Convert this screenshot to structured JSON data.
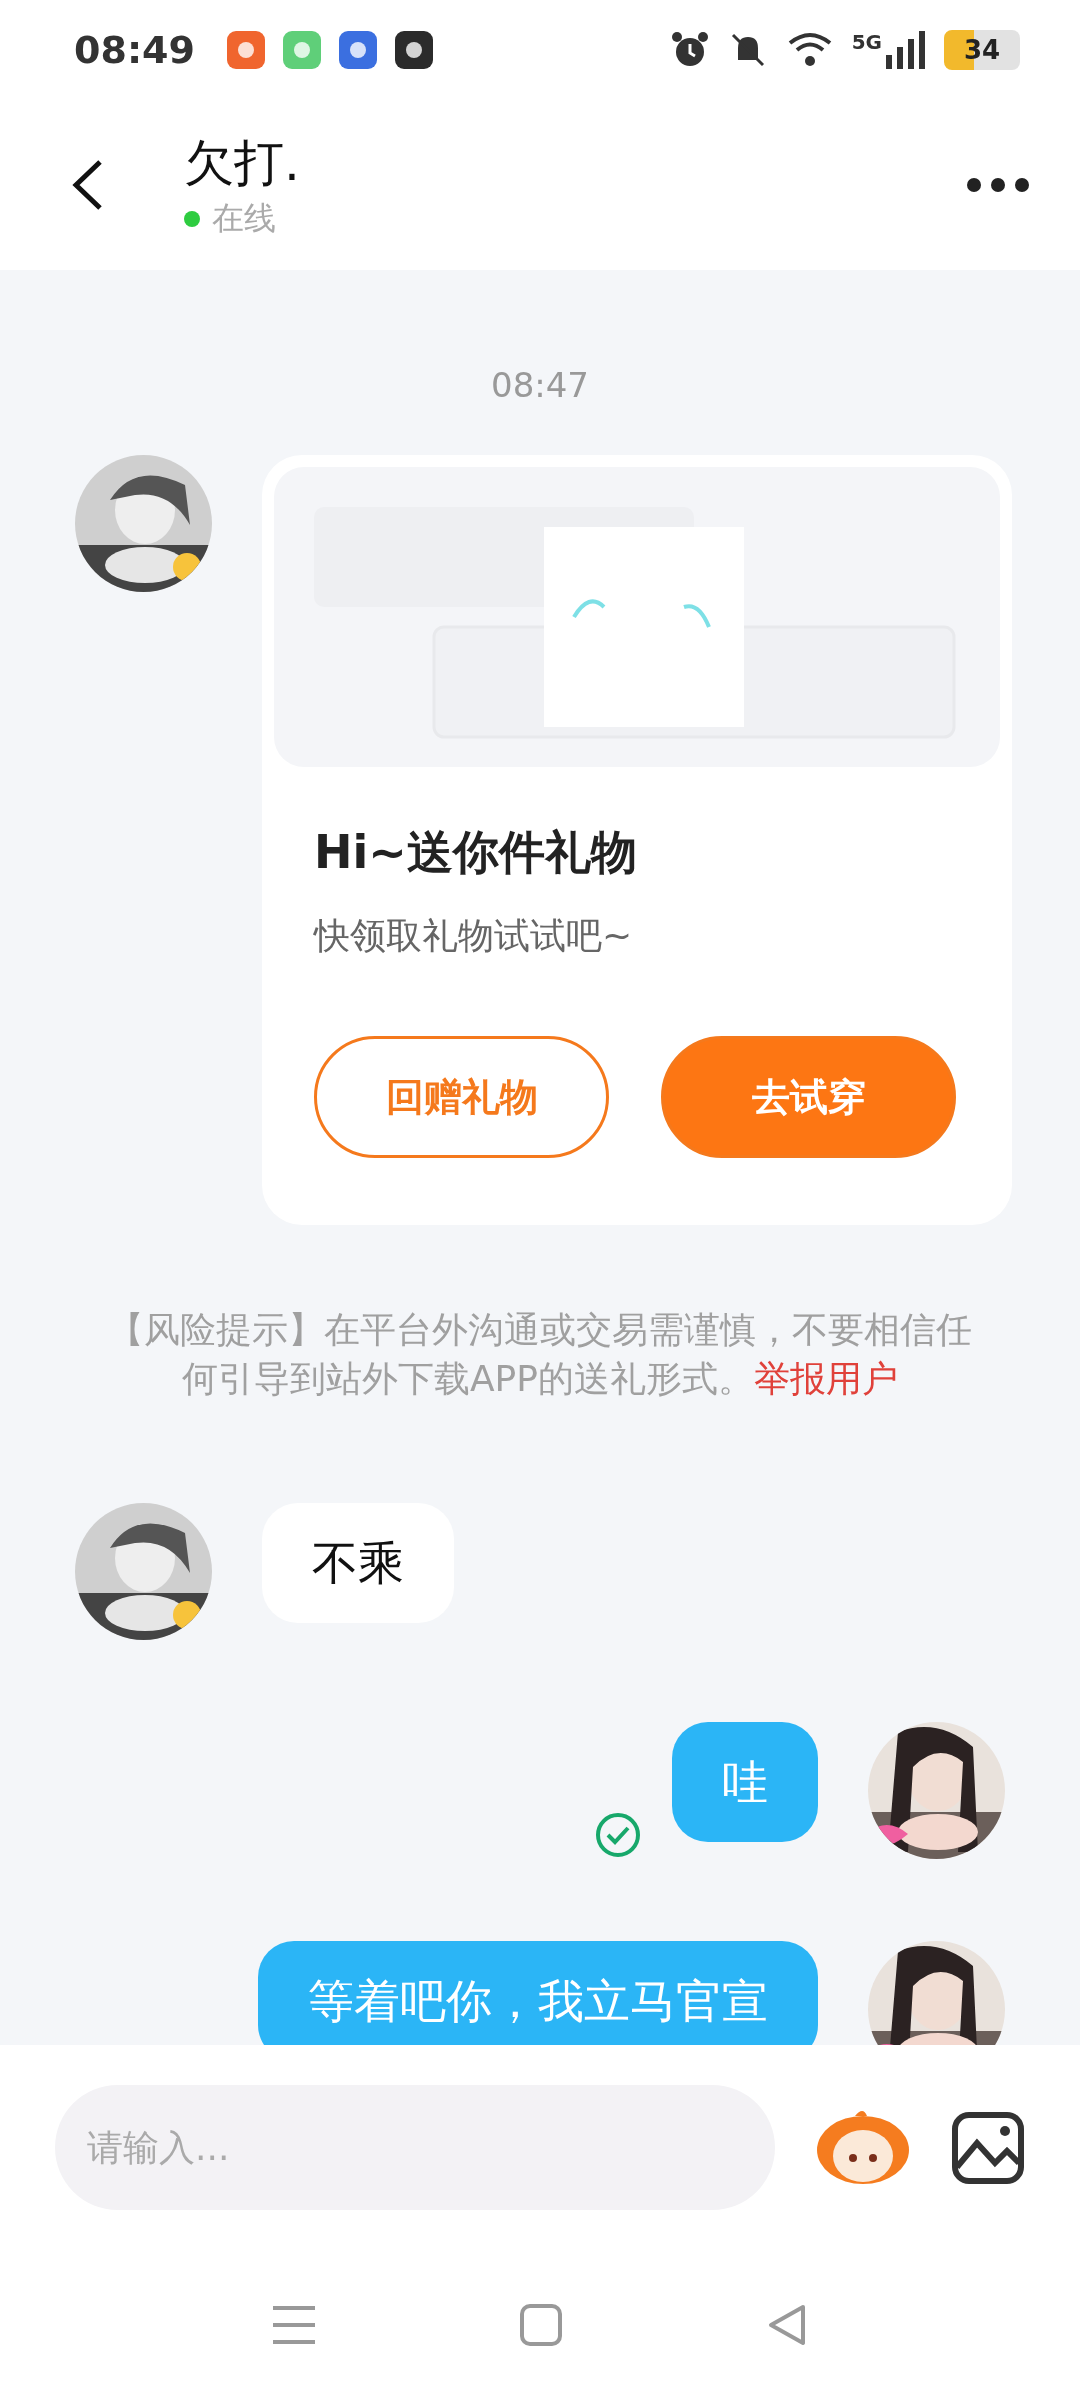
{
  "status_bar": {
    "time": "08:49",
    "network": "5G",
    "battery": "34"
  },
  "header": {
    "title": "欠打.",
    "status": "在线",
    "online": true
  },
  "timestamp": "08:47",
  "messages": [
    {
      "kind": "gift",
      "outgoing": false,
      "title": "Hi~送你件礼物",
      "subtitle": "快领取礼物试试吧~",
      "buttons": [
        {
          "label": "回赠礼物",
          "primary": false
        },
        {
          "label": "去试穿",
          "primary": true
        }
      ]
    },
    {
      "kind": "notice",
      "text": "【风险提示】在平台外沟通或交易需谨慎，不要相信任何引导到站外下载APP的送礼形式。",
      "link": "举报用户"
    },
    {
      "kind": "text",
      "outgoing": false,
      "text": "不乘"
    },
    {
      "kind": "text",
      "outgoing": true,
      "text": "哇",
      "read": true
    },
    {
      "kind": "text",
      "outgoing": true,
      "text": "等着吧你，我立马官宣"
    }
  ],
  "input": {
    "placeholder": "请输入..."
  }
}
